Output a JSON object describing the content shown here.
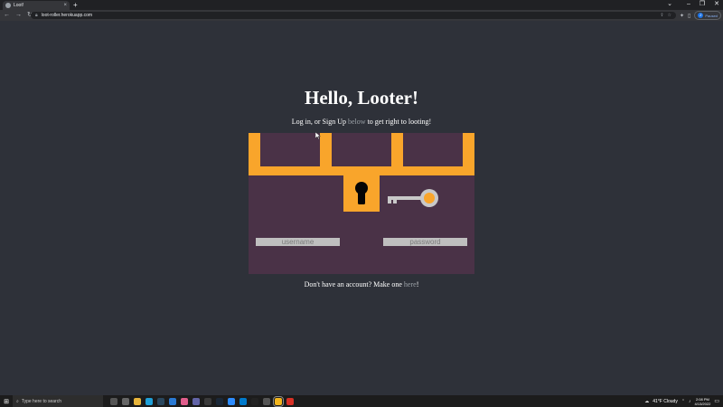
{
  "browser": {
    "tab_title": "Loot!",
    "tab_close": "×",
    "new_tab": "+",
    "window_controls": {
      "chevron": "⌄",
      "minimize": "–",
      "maximize": "❐",
      "close": "✕"
    },
    "nav": {
      "back": "←",
      "forward": "→",
      "reload": "↻"
    },
    "url": "loot-roller.herokuapp.com",
    "profile_status": "Paused",
    "profile_initial": "Z",
    "menu_icon": "⋮",
    "toolbar_icons": [
      "share-icon",
      "star-icon",
      "extensions-icon",
      "side-panel-icon"
    ]
  },
  "page": {
    "heading": "Hello, Looter!",
    "intro": {
      "before": "Log in, or Sign Up ",
      "link": "below",
      "after": " to get right to looting!"
    },
    "form": {
      "username_placeholder": "username",
      "password_placeholder": "password"
    },
    "signup": {
      "before": "Don't have an account? Make one ",
      "link": "here",
      "after": "!"
    },
    "colors": {
      "background": "#2e3139",
      "chest_gold": "#f9a52b",
      "chest_body": "#4a3247",
      "key_silver": "#c8c8c8",
      "input_bg": "#bfbfbf"
    }
  },
  "taskbar": {
    "search_placeholder": "Type here to search",
    "apps": [
      {
        "name": "task-view-icon",
        "color": "#555555"
      },
      {
        "name": "widgets-icon",
        "color": "#666666"
      },
      {
        "name": "file-explorer-icon",
        "color": "#e8b53b"
      },
      {
        "name": "edge-icon",
        "color": "#1fa0d8"
      },
      {
        "name": "steam-icon",
        "color": "#2a475e"
      },
      {
        "name": "store-icon",
        "color": "#2a7ad4"
      },
      {
        "name": "discord-app-icon",
        "color": "#e05d8c"
      },
      {
        "name": "teams-icon",
        "color": "#6264a7"
      },
      {
        "name": "terminal-icon",
        "color": "#3a3a3a"
      },
      {
        "name": "steam-2-icon",
        "color": "#1b2838"
      },
      {
        "name": "zoom-icon",
        "color": "#2d8cff"
      },
      {
        "name": "vscode-icon",
        "color": "#007acc"
      },
      {
        "name": "game-icon",
        "color": "#222222"
      },
      {
        "name": "unity-icon",
        "color": "#555555"
      },
      {
        "name": "chrome-icon",
        "color": "#f2b51c"
      },
      {
        "name": "record-icon",
        "color": "#d93025"
      }
    ],
    "active_app": "chrome-icon",
    "weather": "41°F  Cloudy",
    "time": "2:08 PM",
    "date": "4/13/2022"
  }
}
